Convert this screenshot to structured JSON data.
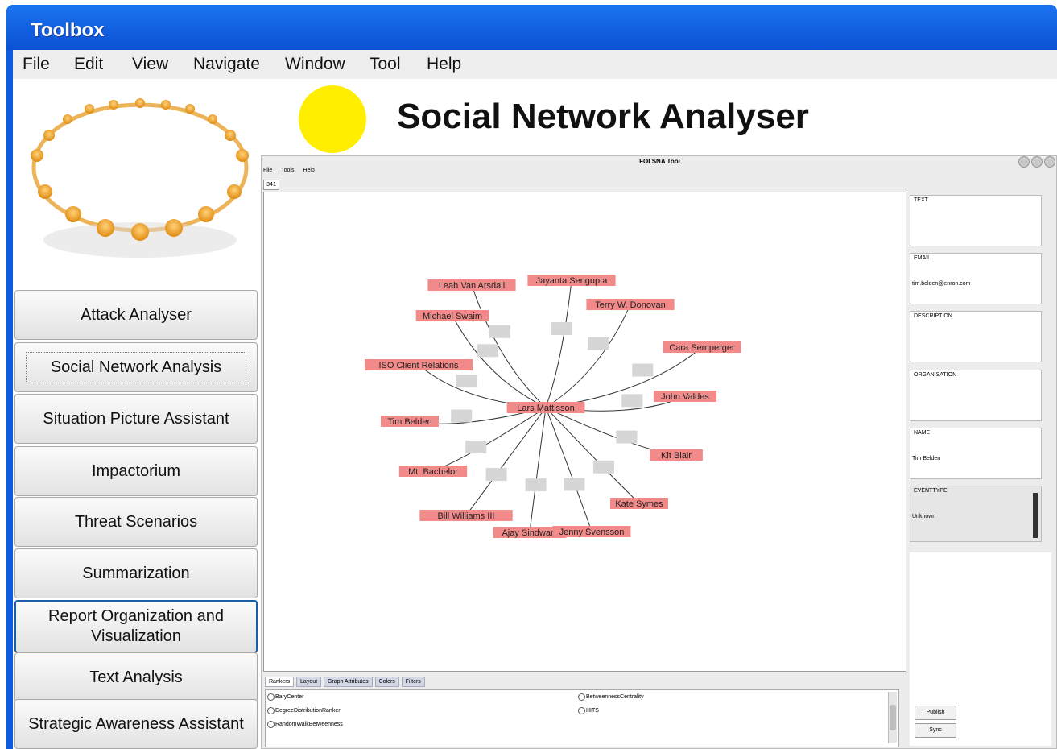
{
  "window": {
    "title": "Toolbox"
  },
  "menu": [
    "File",
    "Edit",
    "View",
    "Navigate",
    "Window",
    "Tool",
    "Help"
  ],
  "sidebar": {
    "items": [
      {
        "label": "Attack Analyser"
      },
      {
        "label": "Social Network Analysis",
        "selected": true
      },
      {
        "label": "Situation Picture Assistant"
      },
      {
        "label": "Impactorium"
      },
      {
        "label": "Threat Scenarios"
      },
      {
        "label": "Summarization"
      },
      {
        "label": "Report Organization and Visualization"
      },
      {
        "label": "Text Analysis"
      },
      {
        "label": "Strategic Awareness Assistant"
      }
    ]
  },
  "main": {
    "headline": "Social Network Analyser",
    "dot_color": "#ffee00"
  },
  "sna": {
    "title": "FOI SNA Tool",
    "menu": [
      "File",
      "Tools",
      "Help"
    ],
    "count": "341",
    "graph": {
      "center": "Lars Mattisson",
      "nodes": [
        "Leah Van Arsdall",
        "Jayanta Sengupta",
        "Terry W. Donovan",
        "Michael Swaim",
        "Cara Semperger",
        "ISO Client Relations",
        "John Valdes",
        "Tim Belden",
        "Kit Blair",
        "Mt. Bachelor",
        "Kate Symes",
        "Bill Williams III",
        "Ajay Sindwani",
        "Jenny Svensson"
      ],
      "node_color": "#f28a8a",
      "edge_icon": "email-envelope-icon"
    },
    "tabs": [
      "Rankers",
      "Layout",
      "Graph Attributes",
      "Colors",
      "Filters"
    ],
    "rankers": [
      "BaryCenter",
      "DegreeDistributionRanker",
      "RandomWalkBetweenness",
      "BetweennessCentrality",
      "HITS"
    ],
    "attributes": [
      {
        "label": "TEXT",
        "value": ""
      },
      {
        "label": "EMAIL",
        "value": "tim.belden@enron.com"
      },
      {
        "label": "DESCRIPTION",
        "value": ""
      },
      {
        "label": "ORGANISATION",
        "value": ""
      },
      {
        "label": "NAME",
        "value": "Tim Belden"
      },
      {
        "label": "EVENTTYPE",
        "value": "Unknown"
      }
    ],
    "buttons": {
      "publish": "Publish",
      "sync": "Sync"
    }
  }
}
